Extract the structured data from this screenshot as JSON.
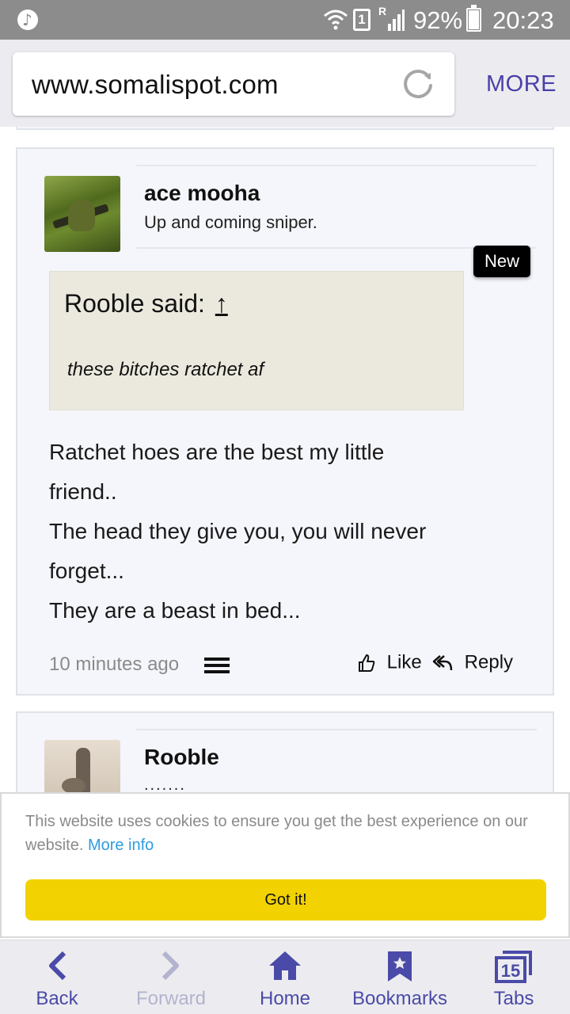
{
  "status_bar": {
    "sim_slot": "1",
    "roaming": "R",
    "battery": "92%",
    "time": "20:23"
  },
  "browser": {
    "url": "www.somalispot.com",
    "more_label": "MORE"
  },
  "posts": [
    {
      "username": "ace mooha",
      "user_title": "Up and coming sniper.",
      "badge": "New",
      "quote": {
        "author": "Rooble said:",
        "arrow": "↑",
        "text": "these bitches ratchet af"
      },
      "message_lines": [
        "Ratchet hoes are the best my little",
        "friend..",
        "The head they give you, you will never",
        "forget...",
        "They are a beast in bed..."
      ],
      "timestamp": "10 minutes ago",
      "like_label": "Like",
      "reply_label": "Reply"
    },
    {
      "username": "Rooble",
      "user_title": "......."
    }
  ],
  "cookie_banner": {
    "text": "This website uses cookies to ensure you get the best experience on our website.",
    "link": "More info",
    "button": "Got it!"
  },
  "bottom_nav": {
    "back": "Back",
    "forward": "Forward",
    "home": "Home",
    "bookmarks": "Bookmarks",
    "tabs": "Tabs",
    "tab_count": "15"
  },
  "colors": {
    "accent": "#4a3fa8",
    "nav_icon": "#4a4aa8",
    "cookie_button": "#f2d200",
    "cookie_link": "#2f9ce0",
    "status_bar": "#8c8c8c"
  }
}
